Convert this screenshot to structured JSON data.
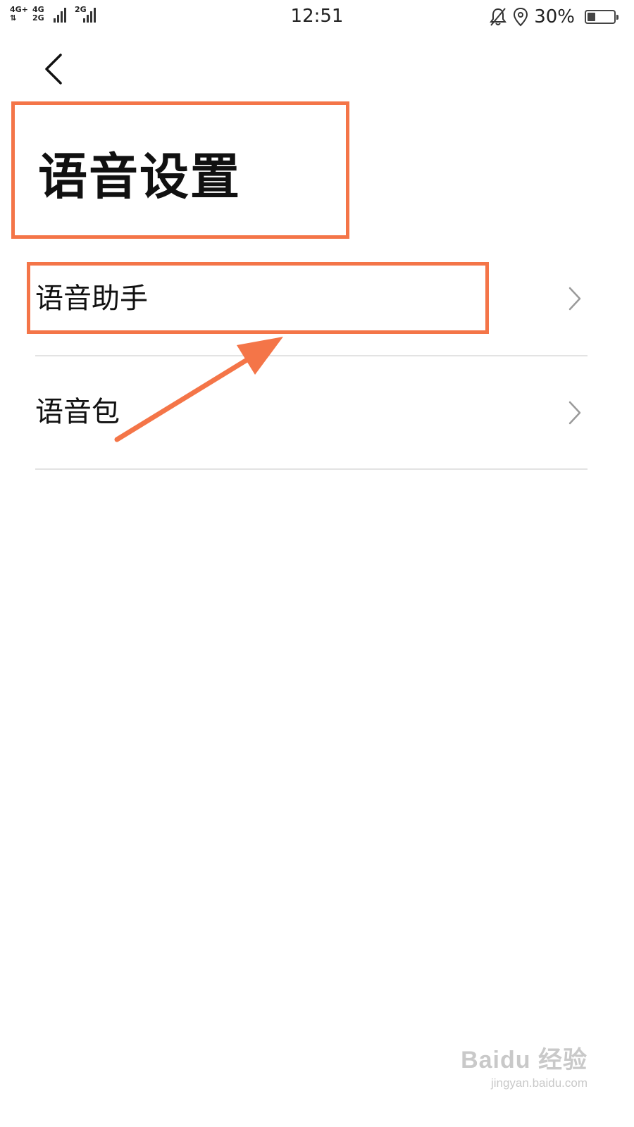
{
  "status_bar": {
    "sim1_top": "4G+",
    "sim1_bottom": "⇅",
    "sim2_top": "4G",
    "sim2_bottom": "2G",
    "sim3": "2G",
    "time": "12:51",
    "battery_percent": "30%",
    "battery_level": 0.3,
    "icons": [
      "bell-muted-icon",
      "location-icon",
      "battery-icon"
    ]
  },
  "header": {
    "back_icon": "chevron-left-icon",
    "title": "语音设置"
  },
  "menu": {
    "items": [
      {
        "label": "语音助手",
        "icon": "chevron-right-icon"
      },
      {
        "label": "语音包",
        "icon": "chevron-right-icon"
      }
    ]
  },
  "annotations": {
    "color": "#f47548"
  },
  "watermark": {
    "text": "Baidu 经验",
    "url": "jingyan.baidu.com"
  }
}
